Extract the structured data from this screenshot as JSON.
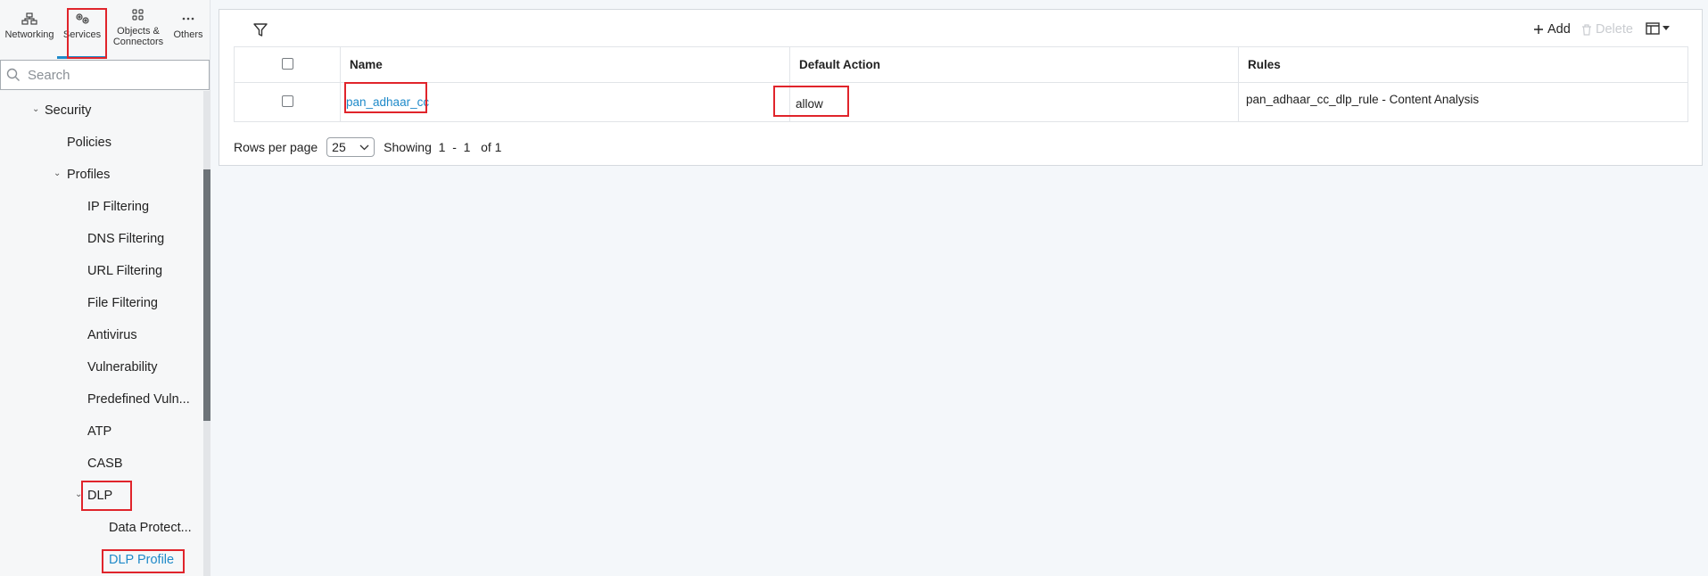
{
  "topnav": {
    "items": [
      {
        "label": "Networking",
        "icon": "network-icon"
      },
      {
        "label": "Services",
        "icon": "gears-icon",
        "active": true
      },
      {
        "label": "Objects & Connectors",
        "icon": "grid-icon"
      },
      {
        "label": "Others",
        "icon": "more-icon"
      }
    ]
  },
  "search": {
    "placeholder": "Search"
  },
  "tree": {
    "security": "Security",
    "policies": "Policies",
    "profiles": "Profiles",
    "ip_filtering": "IP Filtering",
    "dns_filtering": "DNS Filtering",
    "url_filtering": "URL Filtering",
    "file_filtering": "File Filtering",
    "antivirus": "Antivirus",
    "vulnerability": "Vulnerability",
    "predefined_vuln": "Predefined Vuln...",
    "atp": "ATP",
    "casb": "CASB",
    "dlp": "DLP",
    "data_protect": "Data Protect...",
    "dlp_profile": "DLP Profile"
  },
  "toolbar": {
    "add_label": "Add",
    "delete_label": "Delete"
  },
  "table": {
    "headers": {
      "name": "Name",
      "default_action": "Default Action",
      "rules": "Rules"
    },
    "rows": [
      {
        "name": "pan_adhaar_cc",
        "default_action": "allow",
        "rules": "pan_adhaar_cc_dlp_rule - Content Analysis"
      }
    ]
  },
  "footer": {
    "rows_per_page_label": "Rows per page",
    "rows_per_page_value": "25",
    "showing": "Showing  1  -  1   of 1"
  },
  "colors": {
    "accent": "#1f8ac9",
    "highlight": "#e0242b"
  }
}
